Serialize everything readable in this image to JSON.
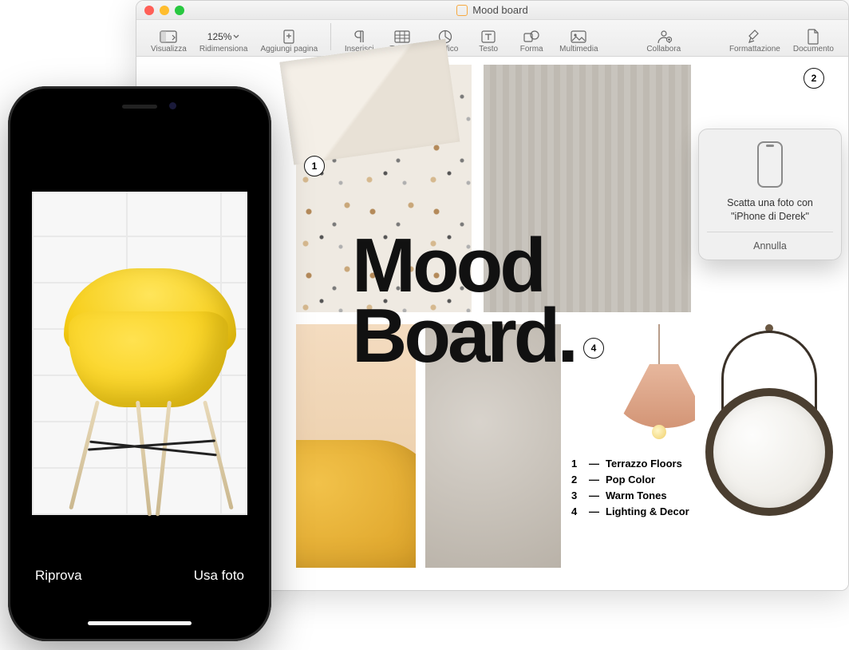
{
  "window": {
    "title": "Mood board"
  },
  "toolbar": {
    "view": "Visualizza",
    "zoom_value": "125%",
    "zoom_label": "Ridimensiona",
    "add_page": "Aggiungi pagina",
    "insert": "Inserisci",
    "table": "Tabella",
    "chart": "Grafico",
    "text": "Testo",
    "shape": "Forma",
    "media": "Multimedia",
    "collab": "Collabora",
    "format": "Formattazione",
    "document": "Documento"
  },
  "doc": {
    "heading_line1": "Mood",
    "heading_line2": "Board.",
    "markers": {
      "m1": "1",
      "m2": "2",
      "m4": "4"
    },
    "legend": [
      {
        "n": "1",
        "dash": "—",
        "label": "Terrazzo Floors"
      },
      {
        "n": "2",
        "dash": "—",
        "label": "Pop Color"
      },
      {
        "n": "3",
        "dash": "—",
        "label": "Warm Tones"
      },
      {
        "n": "4",
        "dash": "—",
        "label": "Lighting & Decor"
      }
    ]
  },
  "popover": {
    "message_l1": "Scatta una foto con",
    "message_l2": "\"iPhone di Derek\"",
    "cancel": "Annulla"
  },
  "iphone": {
    "retake": "Riprova",
    "use_photo": "Usa foto"
  }
}
